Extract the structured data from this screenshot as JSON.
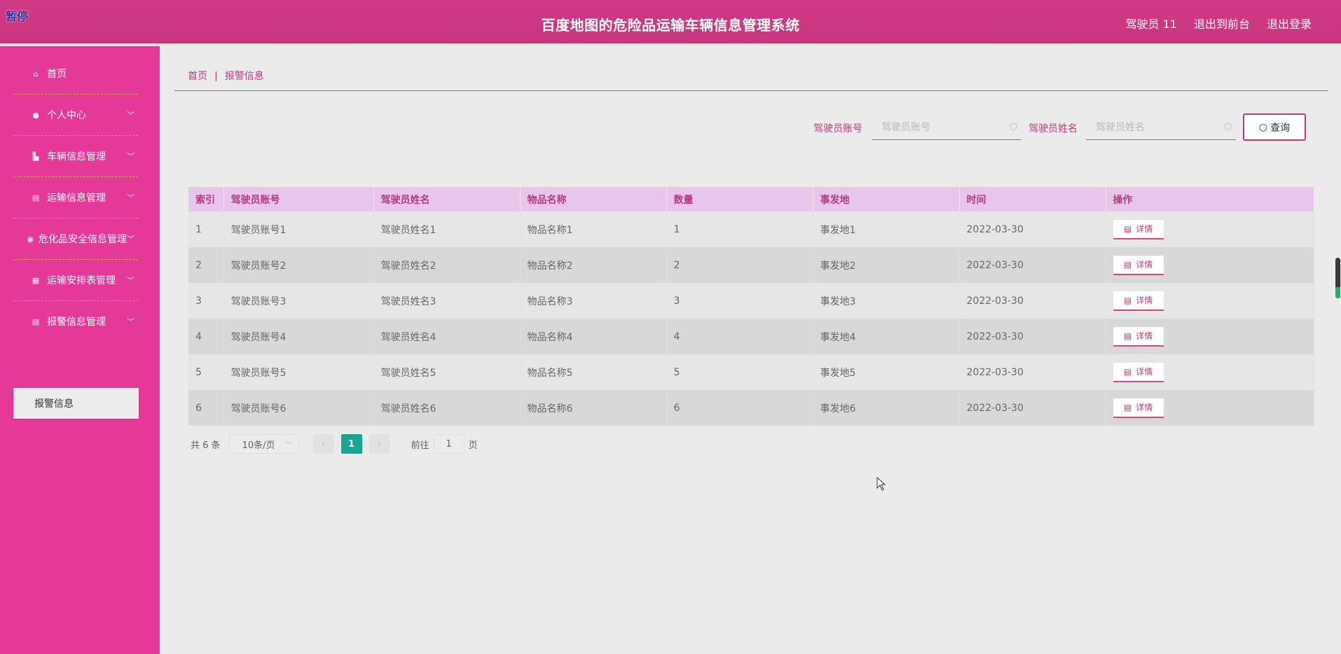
{
  "header": {
    "pause_badge": "暂停",
    "title": "百度地图的危险品运输车辆信息管理系统",
    "user": "驾驶员 11",
    "back_front": "退出到前台",
    "logout": "退出登录"
  },
  "sidebar": {
    "items": [
      {
        "label": "首页",
        "icon": "home-icon"
      },
      {
        "label": "个人中心",
        "icon": "user-icon"
      },
      {
        "label": "车辆信息管理",
        "icon": "vehicle-icon"
      },
      {
        "label": "运输信息管理",
        "icon": "clipboard-icon"
      },
      {
        "label": "危化品安全信息管理",
        "icon": "location-icon"
      },
      {
        "label": "运输安排表管理",
        "icon": "grid-icon"
      },
      {
        "label": "报警信息管理",
        "icon": "clipboard-icon"
      }
    ],
    "active_sub": "报警信息"
  },
  "breadcrumb": {
    "home": "首页",
    "sep": "|",
    "current": "报警信息"
  },
  "search": {
    "account_label": "驾驶员账号",
    "account_placeholder": "驾驶员账号",
    "name_label": "驾驶员姓名",
    "name_placeholder": "驾驶员姓名",
    "query_label": "查询"
  },
  "table": {
    "headers": [
      "索引",
      "驾驶员账号",
      "驾驶员姓名",
      "物品名称",
      "数量",
      "事发地",
      "时间",
      "操作"
    ],
    "detail_label": "详情",
    "rows": [
      [
        "1",
        "驾驶员账号1",
        "驾驶员姓名1",
        "物品名称1",
        "1",
        "事发地1",
        "2022-03-30"
      ],
      [
        "2",
        "驾驶员账号2",
        "驾驶员姓名2",
        "物品名称2",
        "2",
        "事发地2",
        "2022-03-30"
      ],
      [
        "3",
        "驾驶员账号3",
        "驾驶员姓名3",
        "物品名称3",
        "3",
        "事发地3",
        "2022-03-30"
      ],
      [
        "4",
        "驾驶员账号4",
        "驾驶员姓名4",
        "物品名称4",
        "4",
        "事发地4",
        "2022-03-30"
      ],
      [
        "5",
        "驾驶员账号5",
        "驾驶员姓名5",
        "物品名称5",
        "5",
        "事发地5",
        "2022-03-30"
      ],
      [
        "6",
        "驾驶员账号6",
        "驾驶员姓名6",
        "物品名称6",
        "6",
        "事发地6",
        "2022-03-30"
      ]
    ]
  },
  "pagination": {
    "total": "共 6 条",
    "page_size": "10条/页",
    "current_page": "1",
    "goto_label": "前往",
    "goto_value": "1",
    "page_unit": "页"
  },
  "colors": {
    "header": "#cf3a86",
    "sidebar": "#e5399a",
    "accent": "#c03a7c",
    "table_header": "#e8c5ea",
    "pager_active": "#17a693"
  }
}
